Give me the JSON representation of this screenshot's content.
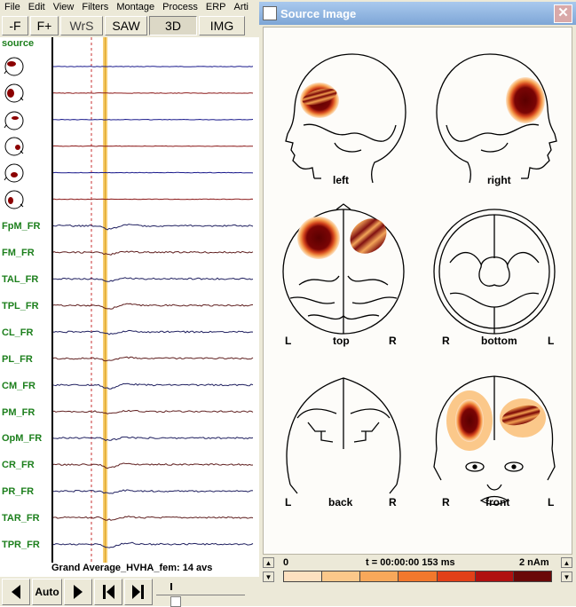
{
  "menu": [
    "File",
    "Edit",
    "View",
    "Filters",
    "Montage",
    "Process",
    "ERP",
    "Arti"
  ],
  "toolbar": {
    "minus_f": "-F",
    "plus_f": "F+",
    "wrs": "WrS",
    "saw": "SAW",
    "three_d": "3D",
    "img": "IMG"
  },
  "channels": {
    "source_header": "source",
    "head_icons": [
      "source-1",
      "source-2",
      "source-3",
      "source-4",
      "source-5",
      "source-6"
    ],
    "labels": [
      "FpM_FR",
      "FM_FR",
      "TAL_FR",
      "TPL_FR",
      "CL_FR",
      "PL_FR",
      "CM_FR",
      "PM_FR",
      "OpM_FR",
      "CR_FR",
      "PR_FR",
      "TAR_FR",
      "TPR_FR"
    ]
  },
  "footer": {
    "average_text": "Grand Average_HVHA_fem: 14 avs",
    "auto_label": "Auto"
  },
  "source_window": {
    "title": "Source Image",
    "close_glyph": "✕",
    "views": {
      "left": "left",
      "right": "right",
      "top": "top",
      "bottom": "bottom",
      "back": "back",
      "front": "front"
    },
    "orient": {
      "top_l": "L",
      "top_r": "R",
      "bottom_r": "R",
      "bottom_l": "L",
      "back_l": "L",
      "back_r": "R",
      "front_r": "R",
      "front_l": "L"
    },
    "colorbar": {
      "min_label": "0",
      "time_label": "t = 00:00:00  153 ms",
      "max_label": "2 nAm",
      "colors": [
        "#fde0c0",
        "#fbc88a",
        "#f8a85a",
        "#f2782c",
        "#e24018",
        "#b01010",
        "#6a0808"
      ]
    }
  }
}
